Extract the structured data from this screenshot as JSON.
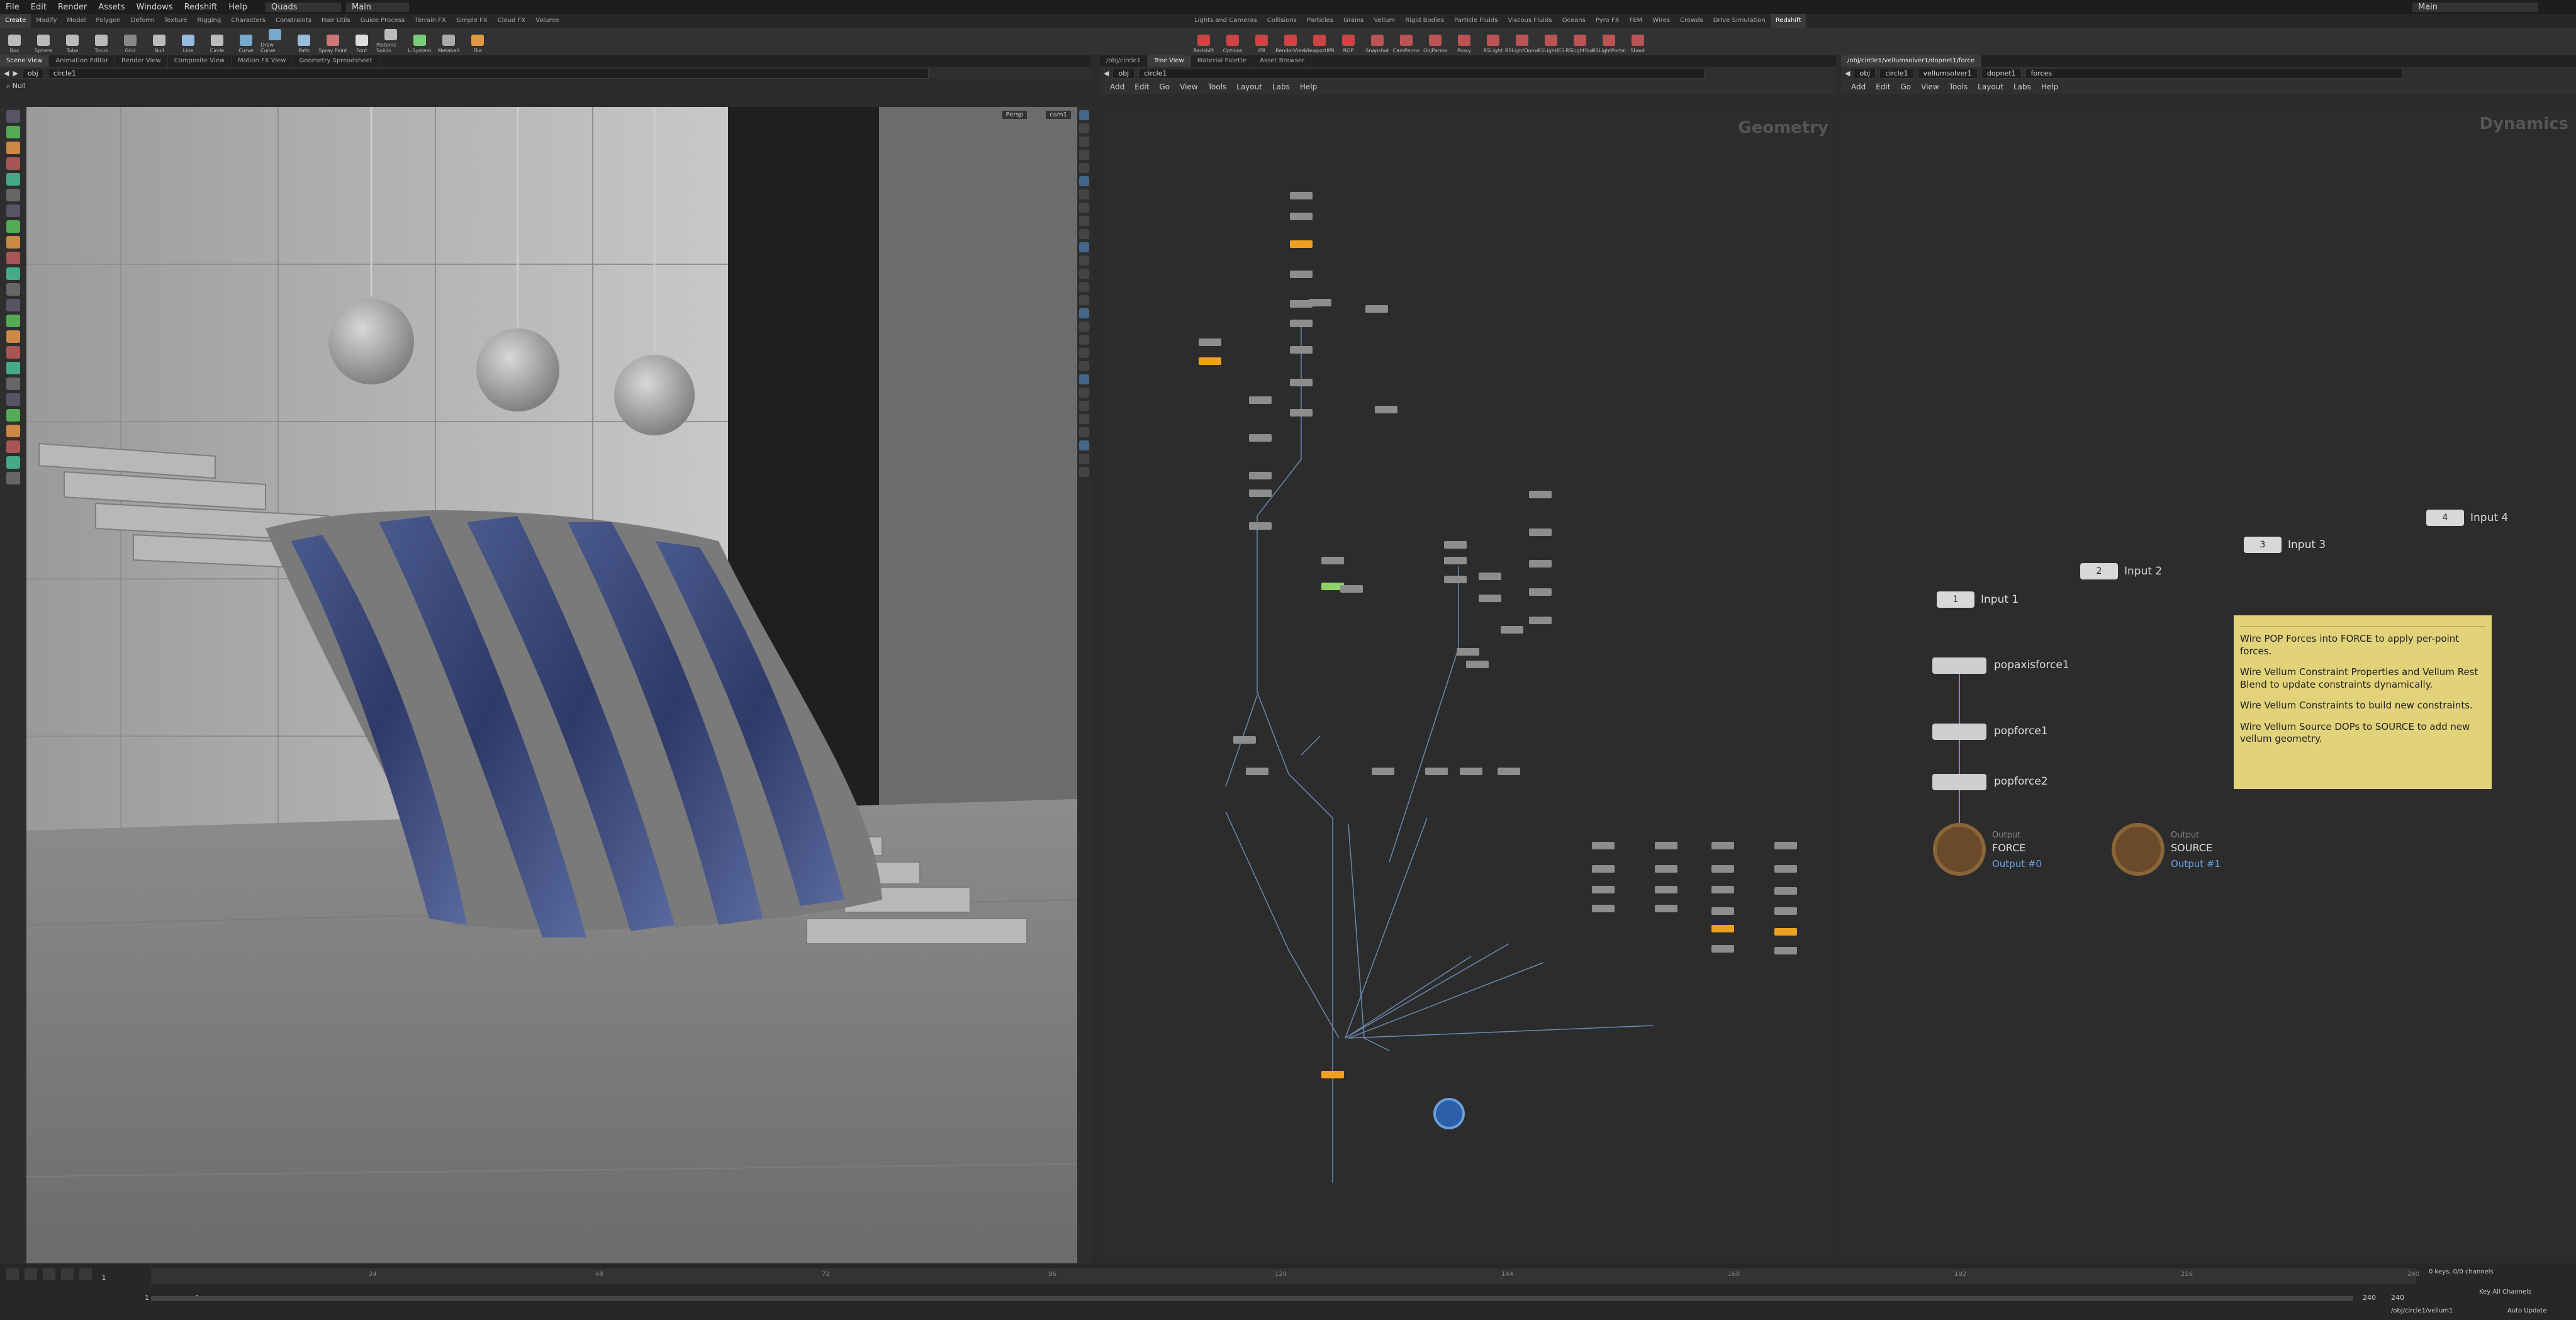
{
  "menubar": {
    "items": [
      "File",
      "Edit",
      "Render",
      "Assets",
      "Windows",
      "Redshift",
      "Help"
    ],
    "desktop": "Quads",
    "context": "Main",
    "right_context": "Main"
  },
  "shelf": {
    "tabs_left": [
      "Create",
      "Modify",
      "Model",
      "Polygon",
      "Deform",
      "Texture",
      "Rigging",
      "Characters",
      "Constraints",
      "Hair Utils",
      "Guide Process",
      "Terrain FX",
      "Simple FX",
      "Cloud FX",
      "Volume"
    ],
    "tools_left": [
      "Box",
      "Sphere",
      "Tube",
      "Torus",
      "Grid",
      "Null",
      "Line",
      "Circle",
      "Curve",
      "Draw Curve",
      "Path",
      "Spray Paint",
      "Font",
      "Platonic Solids",
      "L-System",
      "Metaball",
      "File"
    ],
    "tabs_right": [
      "Lights and Cameras",
      "Collisions",
      "Particles",
      "Grains",
      "Vellum",
      "Rigid Bodies",
      "Particle Fluids",
      "Viscous Fluids",
      "Oceans",
      "Pyro FX",
      "FEM",
      "Wires",
      "Crowds",
      "Drive Simulation",
      "Redshift"
    ],
    "tools_right": [
      "Redshift",
      "Options",
      "IPR",
      "RenderView",
      "ViewportIPR",
      "ROP",
      "Snapshot",
      "CamParms",
      "ObjParms",
      "Proxy",
      "RSLight",
      "RSLightDome",
      "RSLightIES",
      "RSLightSun",
      "RSLightPortal",
      "Shoot"
    ]
  },
  "left_pane": {
    "tabs": [
      "Scene View",
      "Animation Editor",
      "Render View",
      "Composite View",
      "Motion FX View",
      "Geometry Spreadsheet"
    ],
    "path_root": "obj",
    "path_node": "circle1",
    "view_tool": "Null",
    "camera": "Persp",
    "cam_menu": "cam1"
  },
  "mid_pane": {
    "tabs": [
      "/obj/circle1",
      "Tree View",
      "Material Palette",
      "Asset Browser"
    ],
    "path_root": "obj",
    "path_node": "circle1",
    "menu": [
      "Add",
      "Edit",
      "Go",
      "View",
      "Tools",
      "Layout",
      "Labs",
      "Help"
    ],
    "title": "Geometry"
  },
  "right_pane": {
    "tabs": [
      "/obj/circle1/vellumsolver1/dopnet1/force"
    ],
    "path_parts": [
      "obj",
      "circle1",
      "vellumsolver1",
      "dopnet1",
      "forces"
    ],
    "menu": [
      "Add",
      "Edit",
      "Go",
      "View",
      "Tools",
      "Layout",
      "Labs",
      "Help"
    ],
    "title": "Dynamics",
    "inputs": [
      {
        "num": "1",
        "label": "Input 1"
      },
      {
        "num": "2",
        "label": "Input 2"
      },
      {
        "num": "3",
        "label": "Input 3"
      },
      {
        "num": "4",
        "label": "Input 4"
      }
    ],
    "nodes": [
      {
        "label": "popaxisforce1"
      },
      {
        "label": "popforce1"
      },
      {
        "label": "popforce2"
      }
    ],
    "outputs": [
      {
        "type": "Output",
        "name": "FORCE",
        "sub": "Output #0"
      },
      {
        "type": "Output",
        "name": "SOURCE",
        "sub": "Output #1"
      }
    ],
    "sticky": [
      "Wire POP Forces into FORCE to apply per-point forces.",
      "Wire Vellum Constraint Properties and Vellum Rest Blend to update constraints dynamically.",
      "Wire Vellum Constraints to build new constraints.",
      "Wire Vellum Source DOPs to SOURCE to add new vellum geometry."
    ]
  },
  "timeline": {
    "frame": "1",
    "start": "1",
    "end": "1",
    "end_frame": "240",
    "end_frame2": "240",
    "ticks": [
      "24",
      "48",
      "72",
      "96",
      "120",
      "144",
      "168",
      "192",
      "216",
      "240"
    ],
    "keys": "0 keys, 0/0 channels",
    "key_all": "Key All Channels",
    "path": "/obj/circle1/vellum1",
    "autoupdate": "Auto Update"
  },
  "colors": {
    "accent": "#f0a020",
    "sticky": "#e2d27a",
    "cloth": "#3a4a7a"
  }
}
